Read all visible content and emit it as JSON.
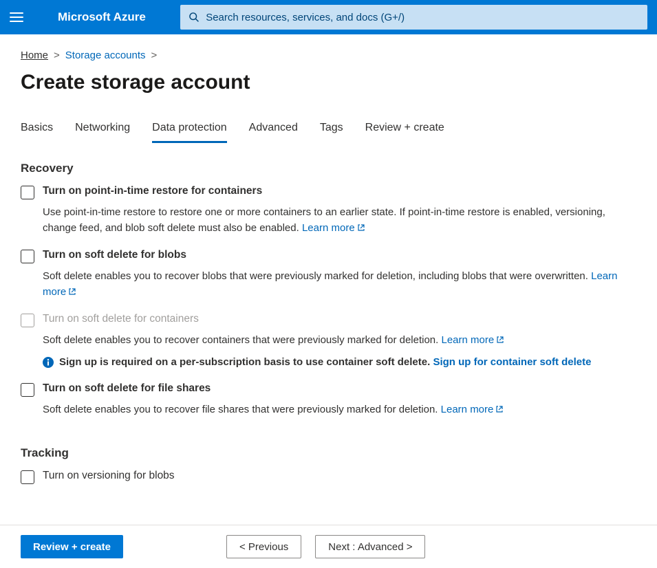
{
  "brand": "Microsoft Azure",
  "search": {
    "placeholder": "Search resources, services, and docs (G+/)"
  },
  "breadcrumbs": {
    "home": "Home",
    "storage_accounts": "Storage accounts"
  },
  "page_title": "Create storage account",
  "tabs": {
    "basics": "Basics",
    "networking": "Networking",
    "data_protection": "Data protection",
    "advanced": "Advanced",
    "tags": "Tags",
    "review_create": "Review + create"
  },
  "sections": {
    "recovery": {
      "title": "Recovery",
      "pitr": {
        "label": "Turn on point-in-time restore for containers",
        "desc": "Use point-in-time restore to restore one or more containers to an earlier state. If point-in-time restore is enabled, versioning, change feed, and blob soft delete must also be enabled.",
        "learn_more": "Learn more"
      },
      "blobs": {
        "label": "Turn on soft delete for blobs",
        "desc": "Soft delete enables you to recover blobs that were previously marked for deletion, including blobs that were overwritten.",
        "learn_more": "Learn more"
      },
      "containers": {
        "label": "Turn on soft delete for containers",
        "desc": "Soft delete enables you to recover containers that were previously marked for deletion.",
        "learn_more": "Learn more",
        "info_text": "Sign up is required on a per-subscription basis to use container soft delete.",
        "info_link": "Sign up for container soft delete"
      },
      "file_shares": {
        "label": "Turn on soft delete for file shares",
        "desc": "Soft delete enables you to recover file shares that were previously marked for deletion.",
        "learn_more": "Learn more"
      }
    },
    "tracking": {
      "title": "Tracking",
      "versioning": {
        "label": "Turn on versioning for blobs"
      }
    }
  },
  "footer": {
    "review_create": "Review + create",
    "previous": "< Previous",
    "next": "Next : Advanced >"
  }
}
